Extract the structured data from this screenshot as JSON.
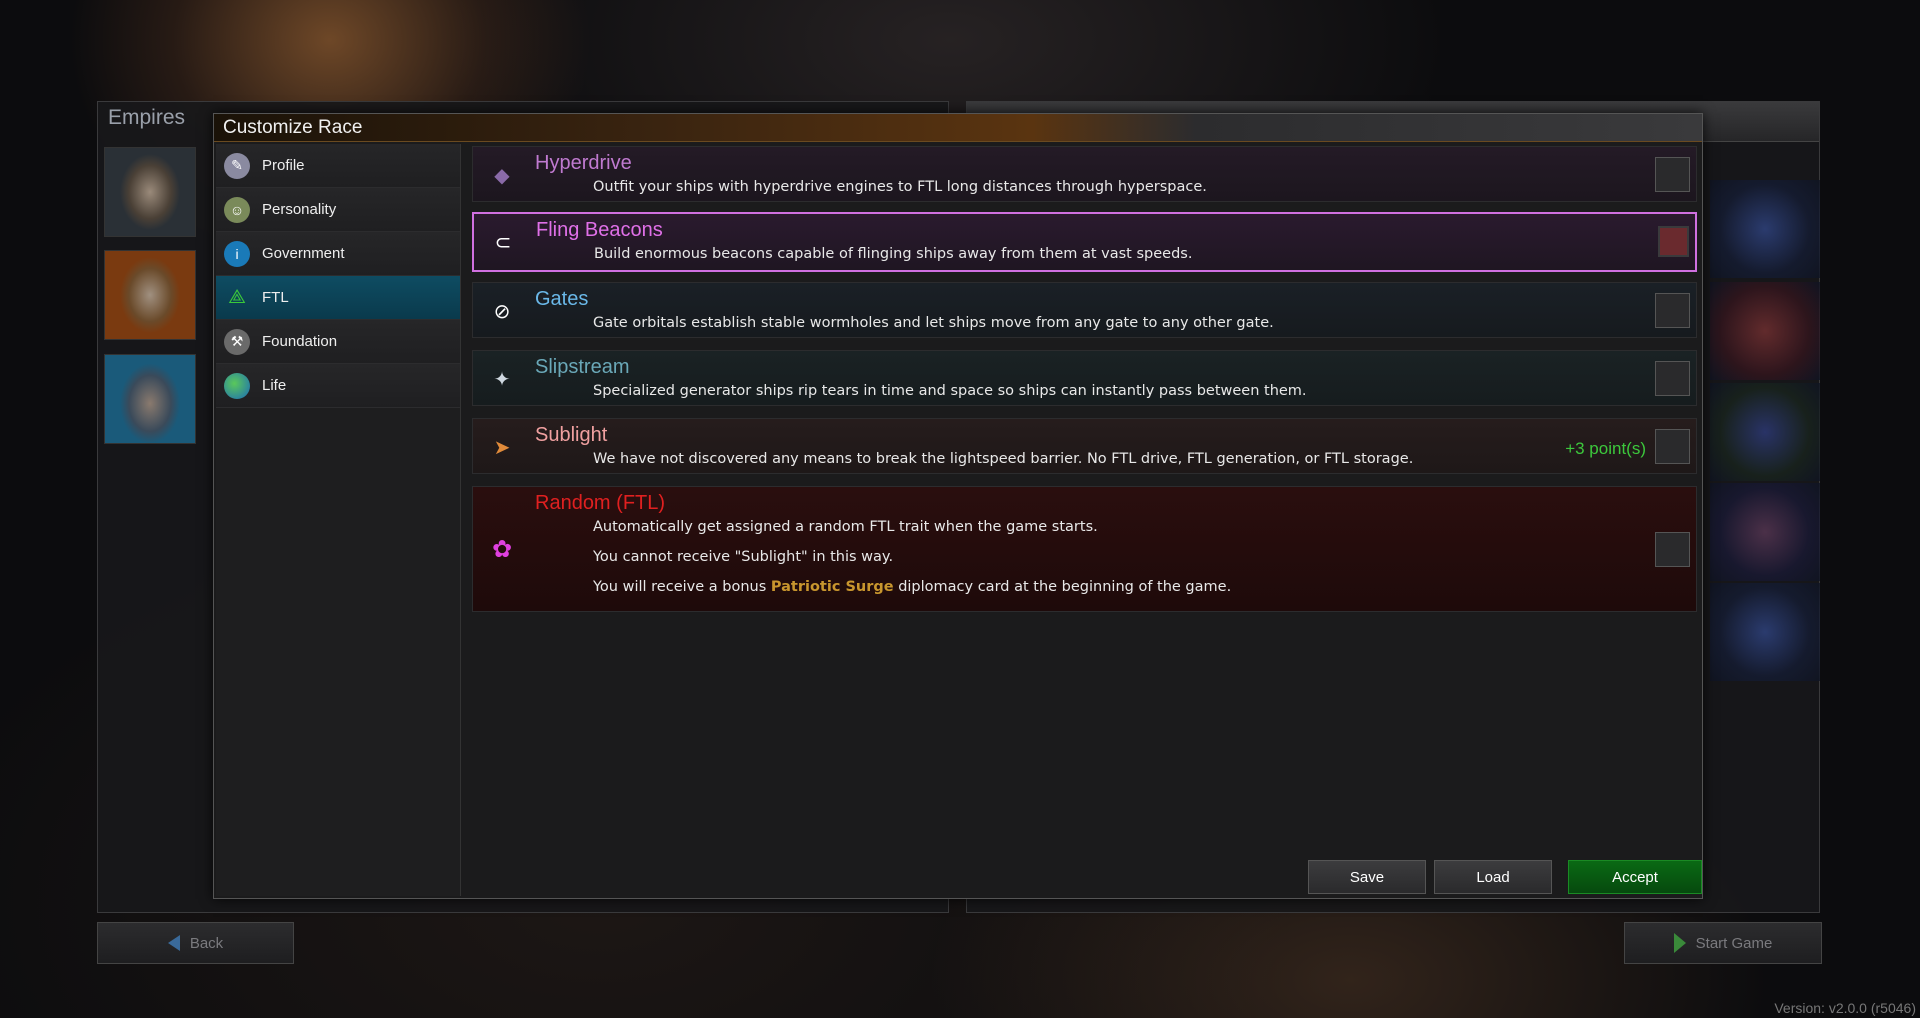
{
  "background": {
    "empires_title": "Empires",
    "back_label": "Back",
    "start_label": "Start Game",
    "version": "Version: v2.0.0 (r5046)"
  },
  "dialog": {
    "title": "Customize Race",
    "buttons": {
      "save": "Save",
      "load": "Load",
      "accept": "Accept"
    }
  },
  "sidebar": {
    "items": [
      {
        "label": "Profile",
        "icon": "profile-icon",
        "active": false
      },
      {
        "label": "Personality",
        "icon": "personality-icon",
        "active": false
      },
      {
        "label": "Government",
        "icon": "government-icon",
        "active": false
      },
      {
        "label": "FTL",
        "icon": "ftl-icon",
        "active": true
      },
      {
        "label": "Foundation",
        "icon": "foundation-icon",
        "active": false
      },
      {
        "label": "Life",
        "icon": "life-icon",
        "active": false
      }
    ]
  },
  "traits": [
    {
      "name": "Hyperdrive",
      "desc": "Outfit your ships with hyperdrive engines to FTL long distances through hyperspace.",
      "name_color": "#c07ad0",
      "selected": false,
      "icon": "hyperdrive-icon"
    },
    {
      "name": "Fling Beacons",
      "desc": "Build enormous beacons capable of flinging ships away from them at vast speeds.",
      "name_color": "#e070e8",
      "selected": true,
      "icon": "fling-beacon-icon"
    },
    {
      "name": "Gates",
      "desc": "Gate orbitals establish stable wormholes and let ships move from any gate to any other gate.",
      "name_color": "#6ab8e8",
      "selected": false,
      "icon": "gate-icon"
    },
    {
      "name": "Slipstream",
      "desc": "Specialized generator ships rip tears in time and space so ships can instantly pass between them.",
      "name_color": "#6aa8b8",
      "selected": false,
      "icon": "slipstream-icon"
    },
    {
      "name": "Sublight",
      "desc": "We have not discovered any means to break the lightspeed barrier. No FTL drive, FTL generation, or FTL storage.",
      "points": "+3 point(s)",
      "name_color": "#f0a0a0",
      "selected": false,
      "icon": "sublight-icon"
    },
    {
      "name": "Random (FTL)",
      "desc_lines": [
        "Automatically get assigned a random FTL trait when the game starts.",
        "You cannot receive \"Sublight\" in this way."
      ],
      "desc_bonus_pre": "You will receive a bonus ",
      "desc_bonus_highlight": "Patriotic Surge",
      "desc_bonus_post": " diplomacy card at the beginning of the game.",
      "name_color": "#e02020",
      "selected": false,
      "icon": "random-icon"
    }
  ]
}
